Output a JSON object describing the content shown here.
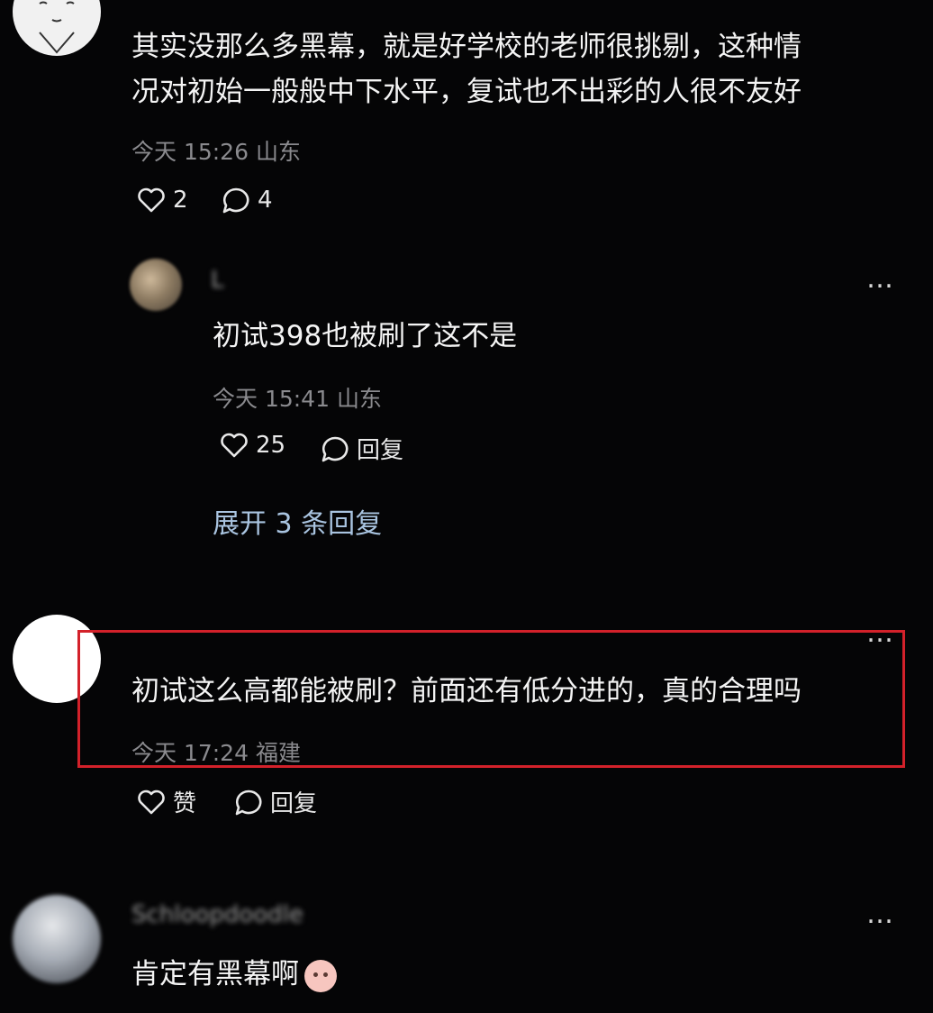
{
  "top_comment": {
    "line1": "其实没那么多黑幕，就是好学校的老师很挑剔，这种情",
    "line2": "况对初始一般般中下水平，复试也不出彩的人很不友好",
    "meta": "今天 15:26 山东",
    "likes": "2",
    "replies": "4"
  },
  "reply": {
    "username": "L",
    "text": "初试398也被刷了这不是",
    "meta": "今天 15:41 山东",
    "likes": "25",
    "reply_label": "回复",
    "more": "…",
    "expand": "展开 3 条回复"
  },
  "highlighted_comment": {
    "text": "初试这么高都能被刷？前面还有低分进的，真的合理吗",
    "meta": "今天 17:24 福建",
    "like_label": "赞",
    "reply_label": "回复",
    "more": "…",
    "highlight_color": "#d3212a"
  },
  "bottom_comment": {
    "username": "Schloopdoodle",
    "text": "肯定有黑幕啊",
    "more": "…"
  },
  "colors": {
    "background": "#050506",
    "text": "#f4f4f4",
    "meta": "#8a8a8e",
    "link": "#a9c4e0"
  },
  "icons": [
    "heart-icon",
    "comment-bubble-icon",
    "more-dots-icon",
    "baby-face-emoji"
  ]
}
